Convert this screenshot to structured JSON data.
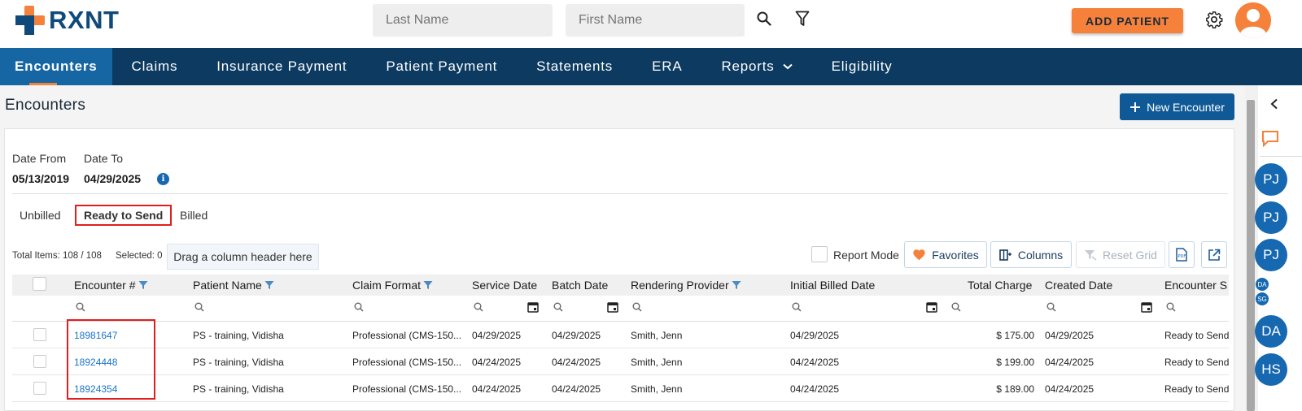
{
  "header": {
    "logo_text": "RXNT",
    "last_name_placeholder": "Last Name",
    "first_name_placeholder": "First Name",
    "add_patient_label": "ADD PATIENT"
  },
  "nav": {
    "items": [
      {
        "label": "Encounters"
      },
      {
        "label": "Claims"
      },
      {
        "label": "Insurance Payment"
      },
      {
        "label": "Patient Payment"
      },
      {
        "label": "Statements"
      },
      {
        "label": "ERA"
      },
      {
        "label": "Reports"
      },
      {
        "label": "Eligibility"
      }
    ]
  },
  "page": {
    "title": "Encounters",
    "new_encounter_label": "New Encounter"
  },
  "filters": {
    "date_from_label": "Date From",
    "date_from_value": "05/13/2019",
    "date_to_label": "Date To",
    "date_to_value": "04/29/2025"
  },
  "tabs": [
    {
      "label": "Unbilled"
    },
    {
      "label": "Ready to Send"
    },
    {
      "label": "Billed"
    }
  ],
  "toolbar": {
    "total_items": "Total Items: 108 / 108",
    "selected": "Selected: 0",
    "drag_hint": "Drag a column header here",
    "report_mode_label": "Report Mode",
    "favorites_label": "Favorites",
    "columns_label": "Columns",
    "reset_grid_label": "Reset Grid"
  },
  "grid": {
    "columns": [
      "Encounter #",
      "Patient Name",
      "Claim Format",
      "Service Date",
      "Batch Date",
      "Rendering Provider",
      "Initial Billed Date",
      "Total Charge",
      "Created Date",
      "Encounter S"
    ],
    "rows": [
      [
        "18981647",
        "PS - training, Vidisha",
        "Professional (CMS-150...",
        "04/29/2025",
        "04/29/2025",
        "Smith, Jenn",
        "04/29/2025",
        "$ 175.00",
        "04/29/2025",
        "Ready to Send"
      ],
      [
        "18924448",
        "PS - training, Vidisha",
        "Professional (CMS-150...",
        "04/24/2025",
        "04/24/2025",
        "Smith, Jenn",
        "04/24/2025",
        "$ 199.00",
        "04/24/2025",
        "Ready to Send"
      ],
      [
        "18924354",
        "PS - training, Vidisha",
        "Professional (CMS-150...",
        "04/24/2025",
        "04/24/2025",
        "Smith, Jenn",
        "04/24/2025",
        "$ 189.00",
        "04/24/2025",
        "Ready to Send"
      ]
    ]
  },
  "side_panel": {
    "avatars": [
      "PJ",
      "PJ",
      "PJ",
      "DA",
      "SG",
      "DA",
      "HS"
    ]
  },
  "colors": {
    "brand_navy": "#0c3a60",
    "brand_orange": "#f5813a",
    "primary_blue": "#0f5a96",
    "highlight_red": "#e01e1e"
  }
}
